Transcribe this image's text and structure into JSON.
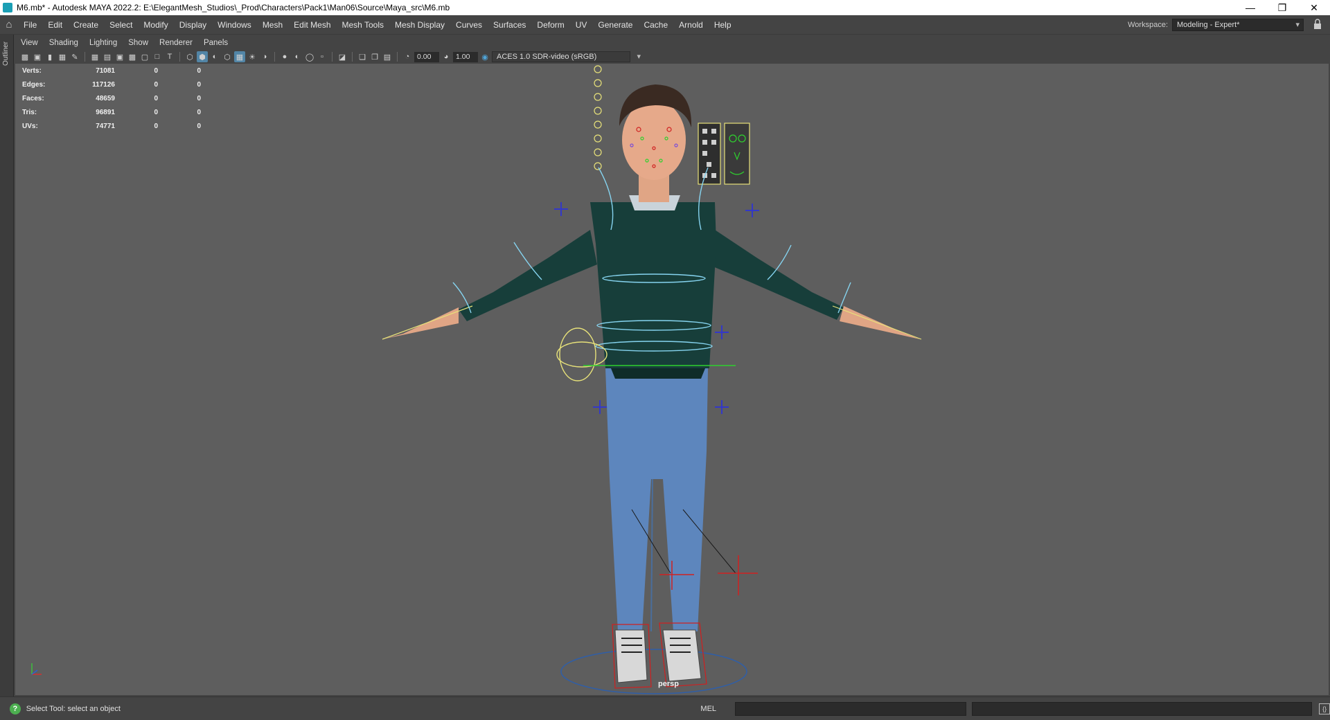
{
  "window": {
    "title": "M6.mb* - Autodesk MAYA 2022.2: E:\\ElegantMesh_Studios\\_Prod\\Characters\\Pack1\\Man06\\Source\\Maya_src\\M6.mb"
  },
  "menubar": {
    "items": [
      "File",
      "Edit",
      "Create",
      "Select",
      "Modify",
      "Display",
      "Windows",
      "Mesh",
      "Edit Mesh",
      "Mesh Tools",
      "Mesh Display",
      "Curves",
      "Surfaces",
      "Deform",
      "UV",
      "Generate",
      "Cache",
      "Arnold",
      "Help"
    ],
    "workspace_label": "Workspace:",
    "workspace_value": "Modeling - Expert*"
  },
  "outliner": {
    "label": "Outliner"
  },
  "panel_menu": {
    "items": [
      "View",
      "Shading",
      "Lighting",
      "Show",
      "Renderer",
      "Panels"
    ]
  },
  "viewport_toolbar": {
    "exposure": "0.00",
    "gamma": "1.00",
    "color_space": "ACES 1.0 SDR-video (sRGB)"
  },
  "hud": {
    "rows": [
      {
        "label": "Verts:",
        "value": "71081",
        "sel": "0",
        "sel2": "0"
      },
      {
        "label": "Edges:",
        "value": "117126",
        "sel": "0",
        "sel2": "0"
      },
      {
        "label": "Faces:",
        "value": "48659",
        "sel": "0",
        "sel2": "0"
      },
      {
        "label": "Tris:",
        "value": "96891",
        "sel": "0",
        "sel2": "0"
      },
      {
        "label": "UVs:",
        "value": "74771",
        "sel": "0",
        "sel2": "0"
      }
    ]
  },
  "viewport": {
    "camera": "persp"
  },
  "statusbar": {
    "message": "Select Tool: select an object",
    "mode": "MEL"
  },
  "colors": {
    "accent": "#5285a6",
    "ctrl_yellow": "#e8e27a",
    "ctrl_blue": "#86d4f0",
    "ctrl_red": "#d02020",
    "sweater": "#173e3a",
    "jeans": "#5d86bd"
  }
}
